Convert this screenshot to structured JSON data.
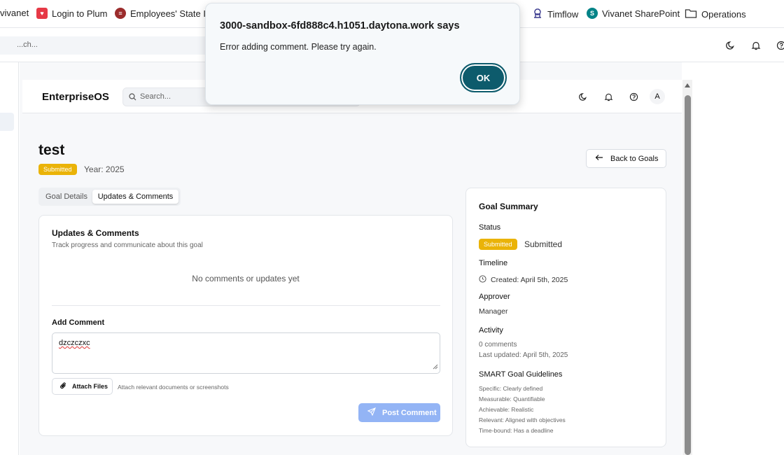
{
  "bookmarks": {
    "items": [
      {
        "label": "vivanet",
        "icon": "blank"
      },
      {
        "label": "Login to Plum",
        "icon": "plum-icon",
        "color": "#e63946"
      },
      {
        "label": "Employees' State In...",
        "icon": "esic-icon",
        "color": "#9b2c2c"
      },
      {
        "label": "Timflow",
        "icon": "timflow-icon"
      },
      {
        "label": "Vivanet SharePoint",
        "icon": "sharepoint-icon",
        "color": "#038387"
      },
      {
        "label": "Operations",
        "icon": "folder-icon"
      }
    ]
  },
  "outer_header": {
    "search_placeholder": "...ch..."
  },
  "app": {
    "brand": "EnterpriseOS",
    "search_placeholder": "Search...",
    "avatar": "A"
  },
  "goal": {
    "title": "test",
    "status_badge": "Submitted",
    "year": "Year: 2025",
    "back_label": "Back to Goals"
  },
  "tabs": [
    {
      "label": "Goal Details",
      "active": false
    },
    {
      "label": "Updates & Comments",
      "active": true
    }
  ],
  "comments": {
    "title": "Updates & Comments",
    "subtitle": "Track progress and communicate about this goal",
    "empty": "No comments or updates yet",
    "add_label": "Add Comment",
    "draft": "dzczczxc",
    "attach_label": "Attach Files",
    "attach_hint": "Attach relevant documents or screenshots",
    "post_label": "Post Comment",
    "post_color": "#93b4f5"
  },
  "summary": {
    "title": "Goal Summary",
    "status_label": "Status",
    "status_badge": "Submitted",
    "status_text": "Submitted",
    "timeline_label": "Timeline",
    "created": "Created: April 5th, 2025",
    "approver_label": "Approver",
    "approver": "Manager",
    "activity_label": "Activity",
    "comments_count": "0 comments",
    "last_updated": "Last updated: April 5th, 2025",
    "guidelines_label": "SMART Goal Guidelines",
    "guidelines": [
      "Specific: Clearly defined",
      "Measurable: Quantifiable",
      "Achievable: Realistic",
      "Relevant: Aligned with objectives",
      "Time-bound: Has a deadline"
    ]
  },
  "dialog": {
    "title": "3000-sandbox-6fd888c4.h1051.daytona.work says",
    "message": "Error adding comment. Please try again.",
    "ok_label": "OK",
    "ok_color": "#0d5b6c"
  },
  "colors": {
    "badge": "#eab308",
    "accent": "#0d5b6c"
  }
}
